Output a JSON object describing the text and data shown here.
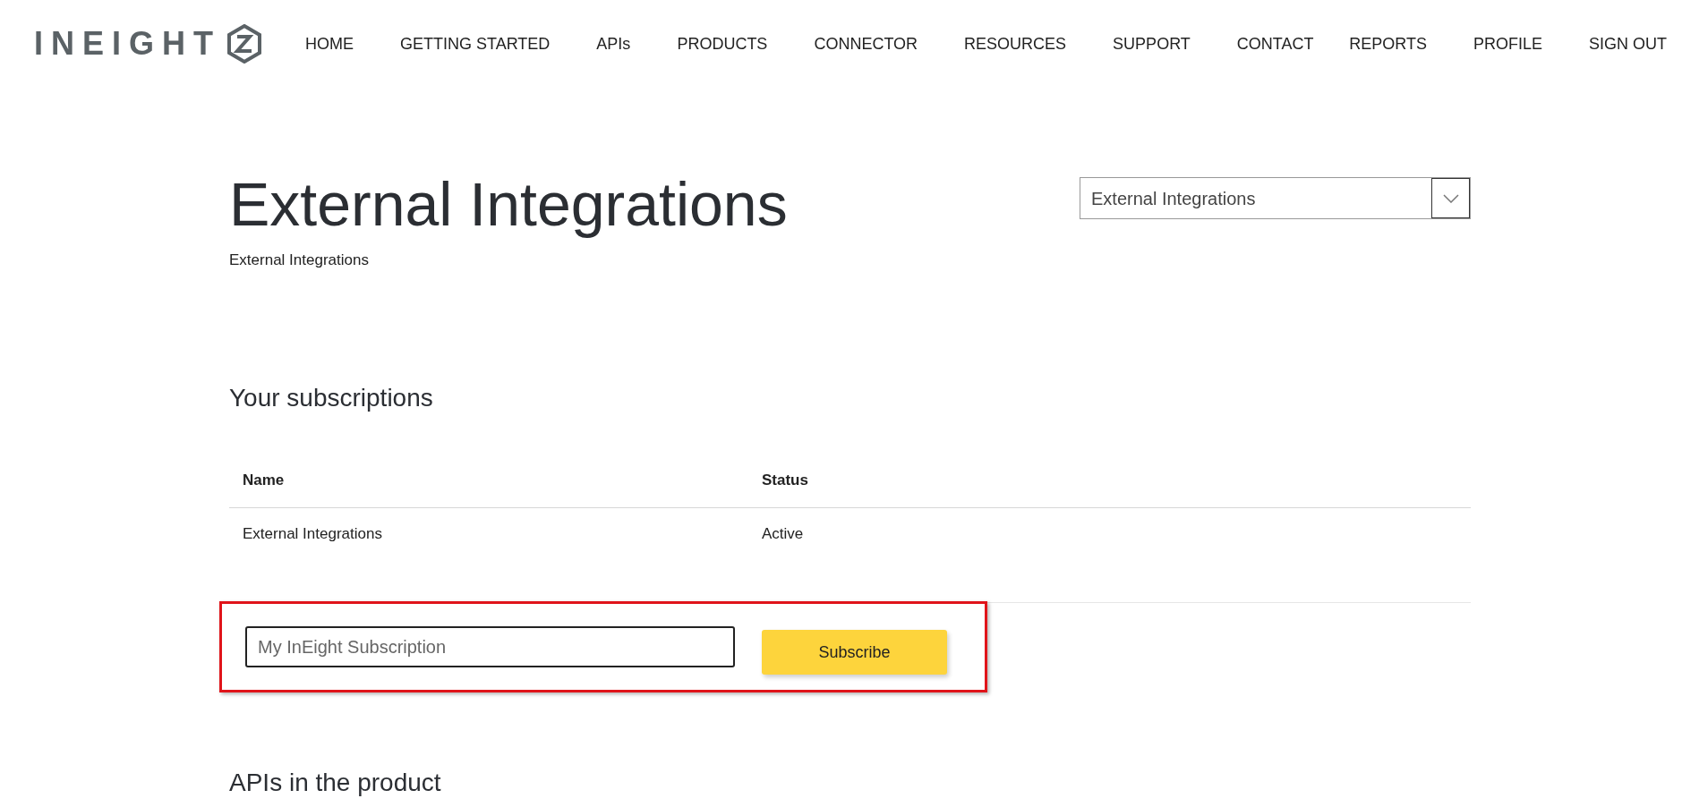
{
  "header": {
    "logo_text": "INEIGHT",
    "nav": [
      "HOME",
      "GETTING STARTED",
      "APIs",
      "PRODUCTS",
      "CONNECTOR",
      "RESOURCES",
      "SUPPORT",
      "CONTACT"
    ],
    "account_nav": [
      "REPORTS",
      "PROFILE",
      "SIGN OUT"
    ]
  },
  "page": {
    "title": "External Integrations",
    "subtitle": "External Integrations",
    "product_select": {
      "value": "External Integrations"
    }
  },
  "subscriptions": {
    "heading": "Your subscriptions",
    "columns": [
      "Name",
      "Status"
    ],
    "rows": [
      {
        "name": "External Integrations",
        "status": "Active"
      }
    ],
    "new_subscription": {
      "placeholder": "My InEight Subscription",
      "button": "Subscribe",
      "highlighted": true
    }
  },
  "apis_section": {
    "heading": "APIs in the product"
  }
}
